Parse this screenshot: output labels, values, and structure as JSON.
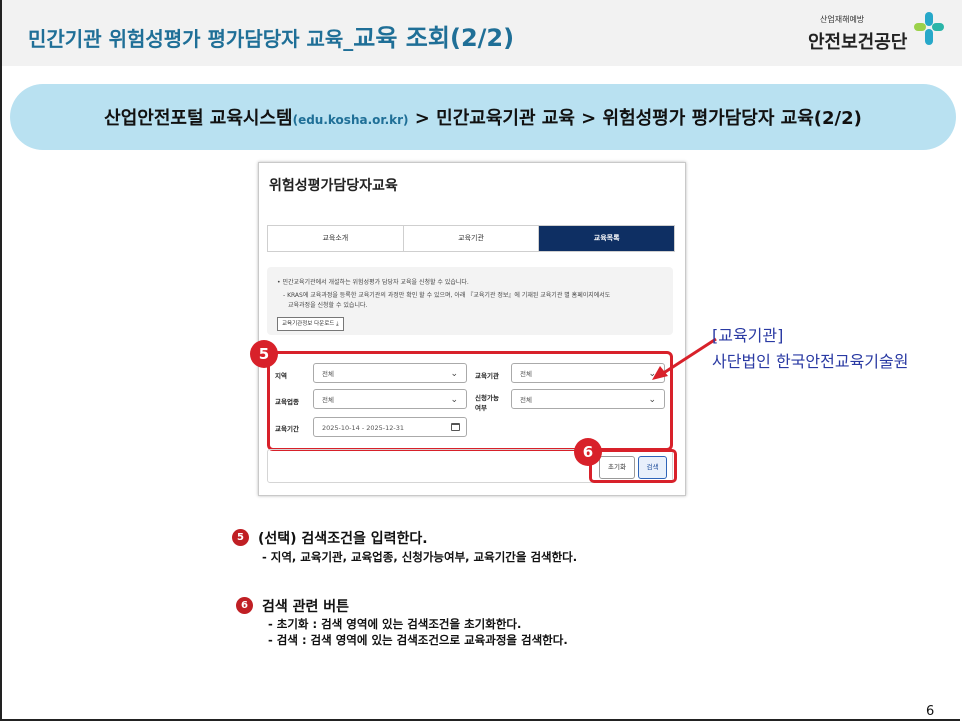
{
  "header": {
    "title_prefix": "민간기관 위험성평가 평가담당자 교육_",
    "title_main": "교육 조회(2/2)",
    "logo_small": "산업재해예방",
    "logo_name": "안전보건공단"
  },
  "banner": {
    "part1": "산업안전포털 교육시스템",
    "url": "(edu.kosha.or.kr)",
    "part2": " > 민간교육기관 교육 > 위험성평가 평가담당자 교육(2/2)"
  },
  "screenshot": {
    "title": "위험성평가담당자교육",
    "tabs": [
      "교육소개",
      "교육기관",
      "교육목록"
    ],
    "active_tab": "교육목록",
    "info_line1": "• 민간교육기관에서 개설하는 위험성평가 담당자 교육을 신청할 수 있습니다.",
    "info_line2": "- KRAS에 교육과정을 등록한 교육기관의 과정만 확인 할 수 있으며, 아래 『교육기관 정보』에 기재된 교육기관 별 홈페이지에서도",
    "info_line3": "교육과정을 신청할 수 있습니다.",
    "download_button": "교육기관정보 다운로드 ⤓",
    "filters": {
      "region_label": "지역",
      "region_value": "전체",
      "institution_label": "교육기관",
      "institution_value": "전체",
      "industry_label": "교육업종",
      "industry_value": "전체",
      "apply_label_1": "신청가능",
      "apply_label_2": "여부",
      "apply_value": "전체",
      "period_label": "교육기간",
      "period_value": "2025-10-14 - 2025-12-31"
    },
    "reset_button": "초기화",
    "search_button": "검색"
  },
  "badges": {
    "five": "5",
    "six": "6"
  },
  "callout": {
    "line1": "[교육기관]",
    "line2": "사단법인 한국안전교육기술원"
  },
  "notes": {
    "n5_title": "(선택) 검색조건을 입력한다.",
    "n5_line": "- 지역, 교육기관, 교육업종, 신청가능여부, 교육기간을 검색한다.",
    "n6_title": "검색 관련 버튼",
    "n6_line1": "- 초기화 : 검색 영역에 있는 검색조건을 초기화한다.",
    "n6_line2": "- 검색 : 검색 영역에 있는 검색조건으로 교육과정을 검색한다."
  },
  "page_number": "6",
  "colors": {
    "header_title": "#1f6f97",
    "banner_bg": "#b9e1f1",
    "highlight_red": "#d8212a",
    "active_tab": "#0e2f63",
    "callout_text": "#2a3aa3"
  }
}
